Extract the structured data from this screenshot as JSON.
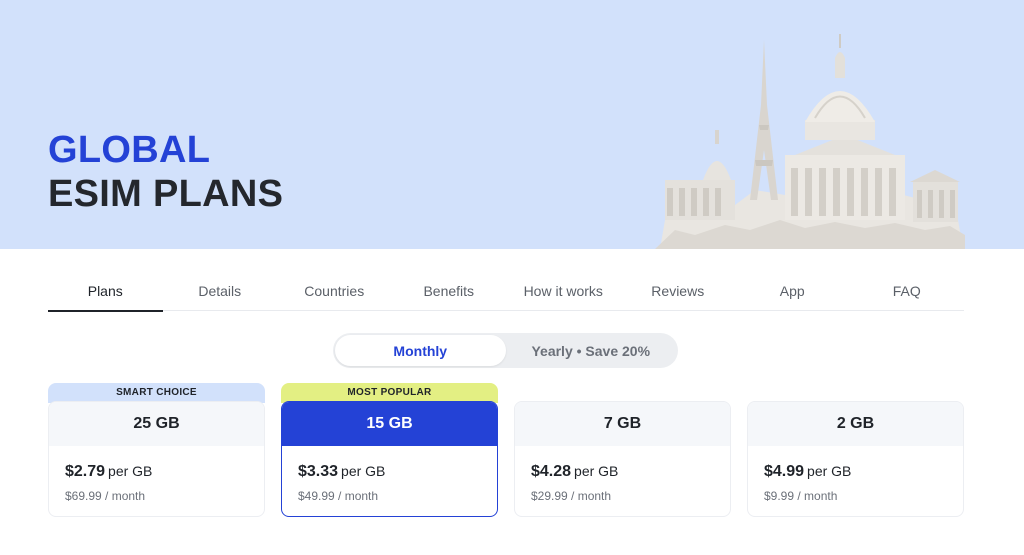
{
  "hero": {
    "title_line1": "GLOBAL",
    "title_line2": "ESIM PLANS",
    "accent_color": "#2442d6",
    "background_color": "#d2e1fb"
  },
  "tabs": [
    {
      "label": "Plans",
      "active": true
    },
    {
      "label": "Details",
      "active": false
    },
    {
      "label": "Countries",
      "active": false
    },
    {
      "label": "Benefits",
      "active": false
    },
    {
      "label": "How it works",
      "active": false
    },
    {
      "label": "Reviews",
      "active": false
    },
    {
      "label": "App",
      "active": false
    },
    {
      "label": "FAQ",
      "active": false
    }
  ],
  "billing_toggle": {
    "monthly": "Monthly",
    "yearly": "Yearly • Save 20%",
    "selected": "monthly"
  },
  "plans": [
    {
      "badge": "SMART CHOICE",
      "badge_color": "#d2e1fb",
      "size": "25 GB",
      "price": "$2.79",
      "unit": "per GB",
      "monthly": "$69.99 / month"
    },
    {
      "badge": "MOST POPULAR",
      "badge_color": "#e3ef83",
      "size": "15 GB",
      "price": "$3.33",
      "unit": "per GB",
      "monthly": "$49.99 / month",
      "selected": true
    },
    {
      "badge": "",
      "size": "7 GB",
      "price": "$4.28",
      "unit": "per GB",
      "monthly": "$29.99 / month"
    },
    {
      "badge": "",
      "size": "2 GB",
      "price": "$4.99",
      "unit": "per GB",
      "monthly": "$9.99 / month"
    }
  ]
}
